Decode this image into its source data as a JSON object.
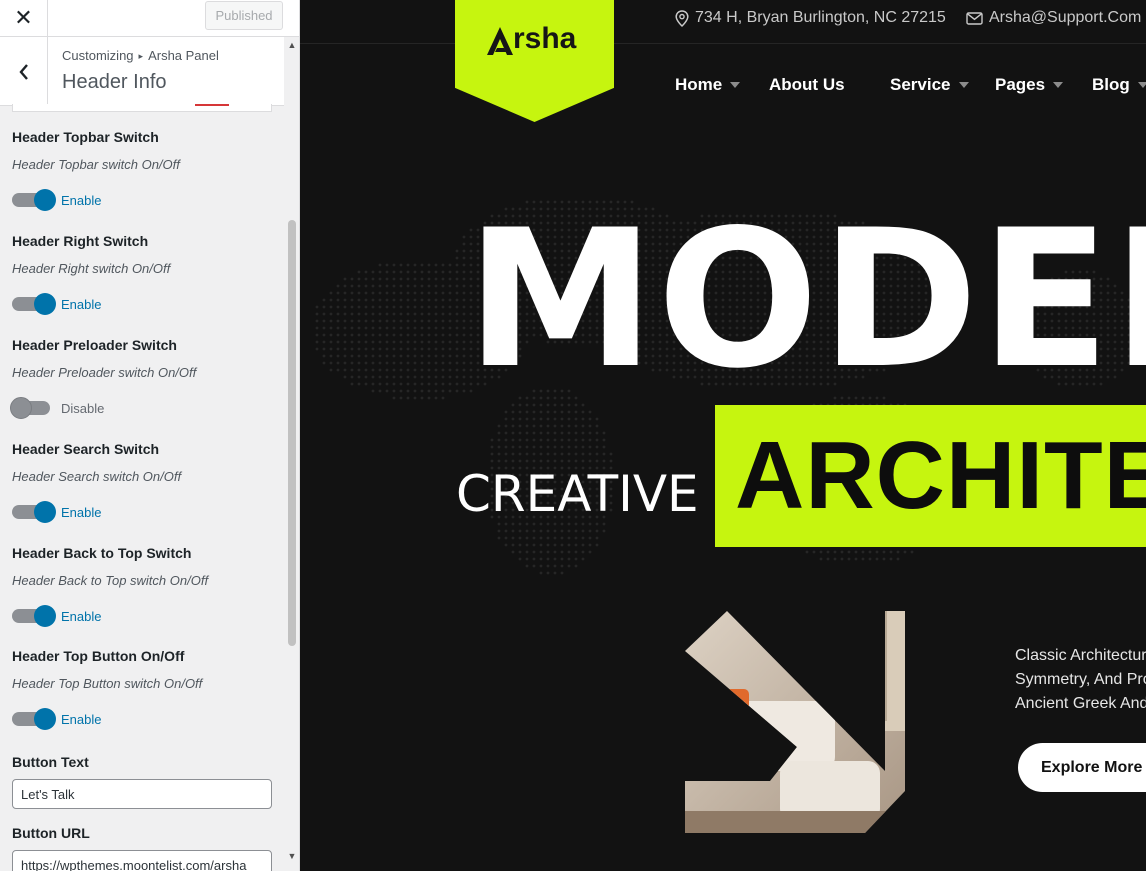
{
  "customizer": {
    "close_icon_glyph": "✕",
    "publish_label": "Published",
    "breadcrumb": {
      "root": "Customizing",
      "separator": "▸",
      "panel": "Arsha Panel"
    },
    "section_title": "Header Info",
    "toggles": [
      {
        "title": "Header Topbar Switch",
        "desc": "Header Topbar switch On/Off",
        "state": "Enable",
        "on": true
      },
      {
        "title": "Header Right Switch",
        "desc": "Header Right switch On/Off",
        "state": "Enable",
        "on": true
      },
      {
        "title": "Header Preloader Switch",
        "desc": "Header Preloader switch On/Off",
        "state": "Disable",
        "on": false
      },
      {
        "title": "Header Search Switch",
        "desc": "Header Search switch On/Off",
        "state": "Enable",
        "on": true
      },
      {
        "title": "Header Back to Top Switch",
        "desc": "Header Back to Top switch On/Off",
        "state": "Enable",
        "on": true
      },
      {
        "title": "Header Top Button On/Off",
        "desc": "Header Top Button switch On/Off",
        "state": "Enable",
        "on": true
      }
    ],
    "button_text": {
      "label": "Button Text",
      "value": "Let's Talk"
    },
    "button_url": {
      "label": "Button URL",
      "value": "https://wpthemes.moontelist.com/arsha"
    },
    "scroll_up_glyph": "▲",
    "scroll_down_glyph": "▼",
    "colors": {
      "accent": "#0073aa",
      "toggle_off": "#8c8f94"
    }
  },
  "preview": {
    "address": "734 H, Bryan Burlington, NC 27215",
    "email": "Arsha@Support.Com",
    "logo_text": "rsha",
    "nav": [
      {
        "label": "Home",
        "caret": true
      },
      {
        "label": "About Us",
        "caret": false
      },
      {
        "label": "Service",
        "caret": true
      },
      {
        "label": "Pages",
        "caret": true
      },
      {
        "label": "Blog",
        "caret": true
      }
    ],
    "hero_title": "MODERN",
    "hero_creative": "CREATIVE",
    "hero_highlight": "ARCHITECTURE",
    "hero_text_lines": [
      "Classic Architecture",
      "Symmetry, And Pro",
      "Ancient Greek And"
    ],
    "cta_label": "Explore More",
    "colors": {
      "lime": "#c6f50f",
      "background": "#121212"
    }
  }
}
